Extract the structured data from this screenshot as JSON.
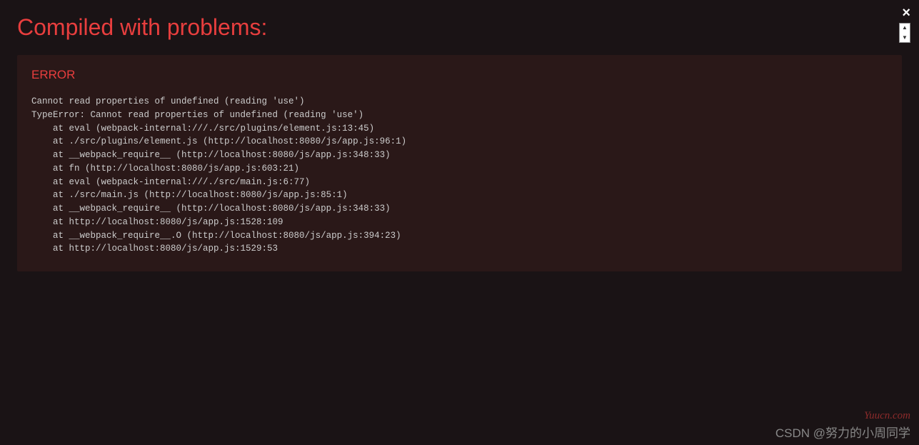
{
  "header": {
    "title": "Compiled with problems:"
  },
  "error": {
    "heading": "ERROR",
    "trace": "Cannot read properties of undefined (reading 'use')\nTypeError: Cannot read properties of undefined (reading 'use')\n    at eval (webpack-internal:///./src/plugins/element.js:13:45)\n    at ./src/plugins/element.js (http://localhost:8080/js/app.js:96:1)\n    at __webpack_require__ (http://localhost:8080/js/app.js:348:33)\n    at fn (http://localhost:8080/js/app.js:603:21)\n    at eval (webpack-internal:///./src/main.js:6:77)\n    at ./src/main.js (http://localhost:8080/js/app.js:85:1)\n    at __webpack_require__ (http://localhost:8080/js/app.js:348:33)\n    at http://localhost:8080/js/app.js:1528:109\n    at __webpack_require__.O (http://localhost:8080/js/app.js:394:23)\n    at http://localhost:8080/js/app.js:1529:53"
  },
  "watermarks": {
    "brand": "Yuucn.com",
    "attribution": "CSDN @努力的小周同学"
  }
}
